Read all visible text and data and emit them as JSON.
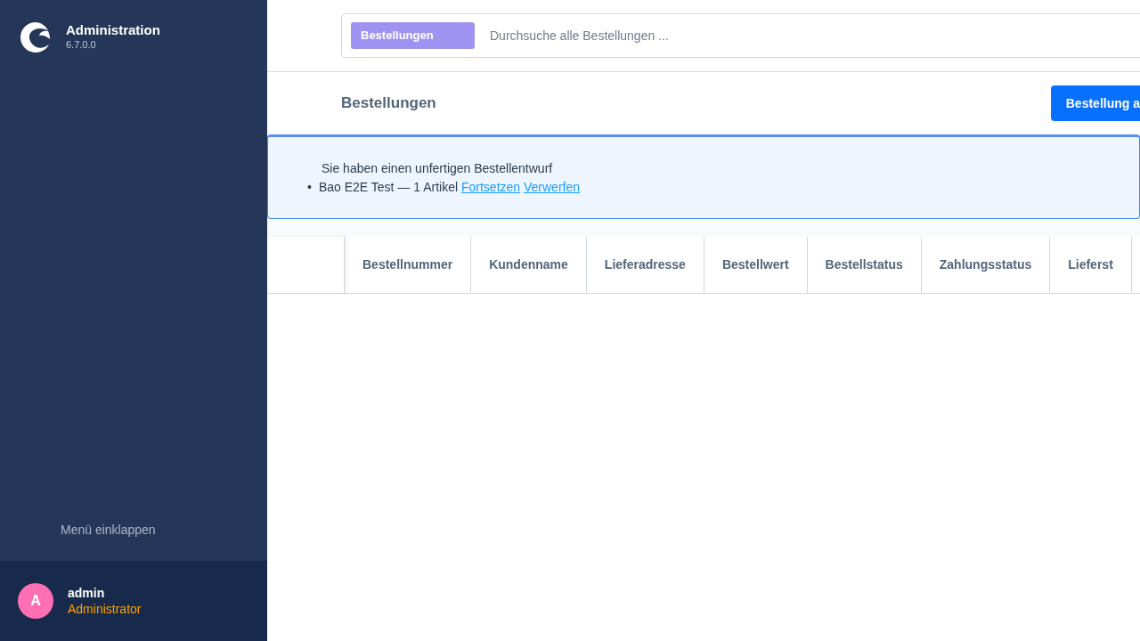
{
  "sidebar": {
    "app_title": "Administration",
    "version": "6.7.0.0",
    "collapse_label": "Menü einklappen",
    "user": {
      "initial": "A",
      "name": "admin",
      "role": "Administrator"
    }
  },
  "search": {
    "module_tag": "Bestellungen",
    "placeholder": "Durchsuche alle Bestellungen ..."
  },
  "header": {
    "title": "Bestellungen",
    "primary_button": "Bestellung a"
  },
  "draft_notice": {
    "heading": "Sie haben einen unfertigen Bestellentwurf",
    "items": [
      {
        "bullet": "•",
        "text": "Bao E2E Test — 1 Artikel",
        "links": [
          "Fortsetzen",
          "Verwerfen"
        ]
      }
    ]
  },
  "table": {
    "columns": [
      "Bestellnummer",
      "Kundenname",
      "Lieferadresse",
      "Bestellwert",
      "Bestellstatus",
      "Zahlungsstatus",
      "Lieferst"
    ]
  }
}
